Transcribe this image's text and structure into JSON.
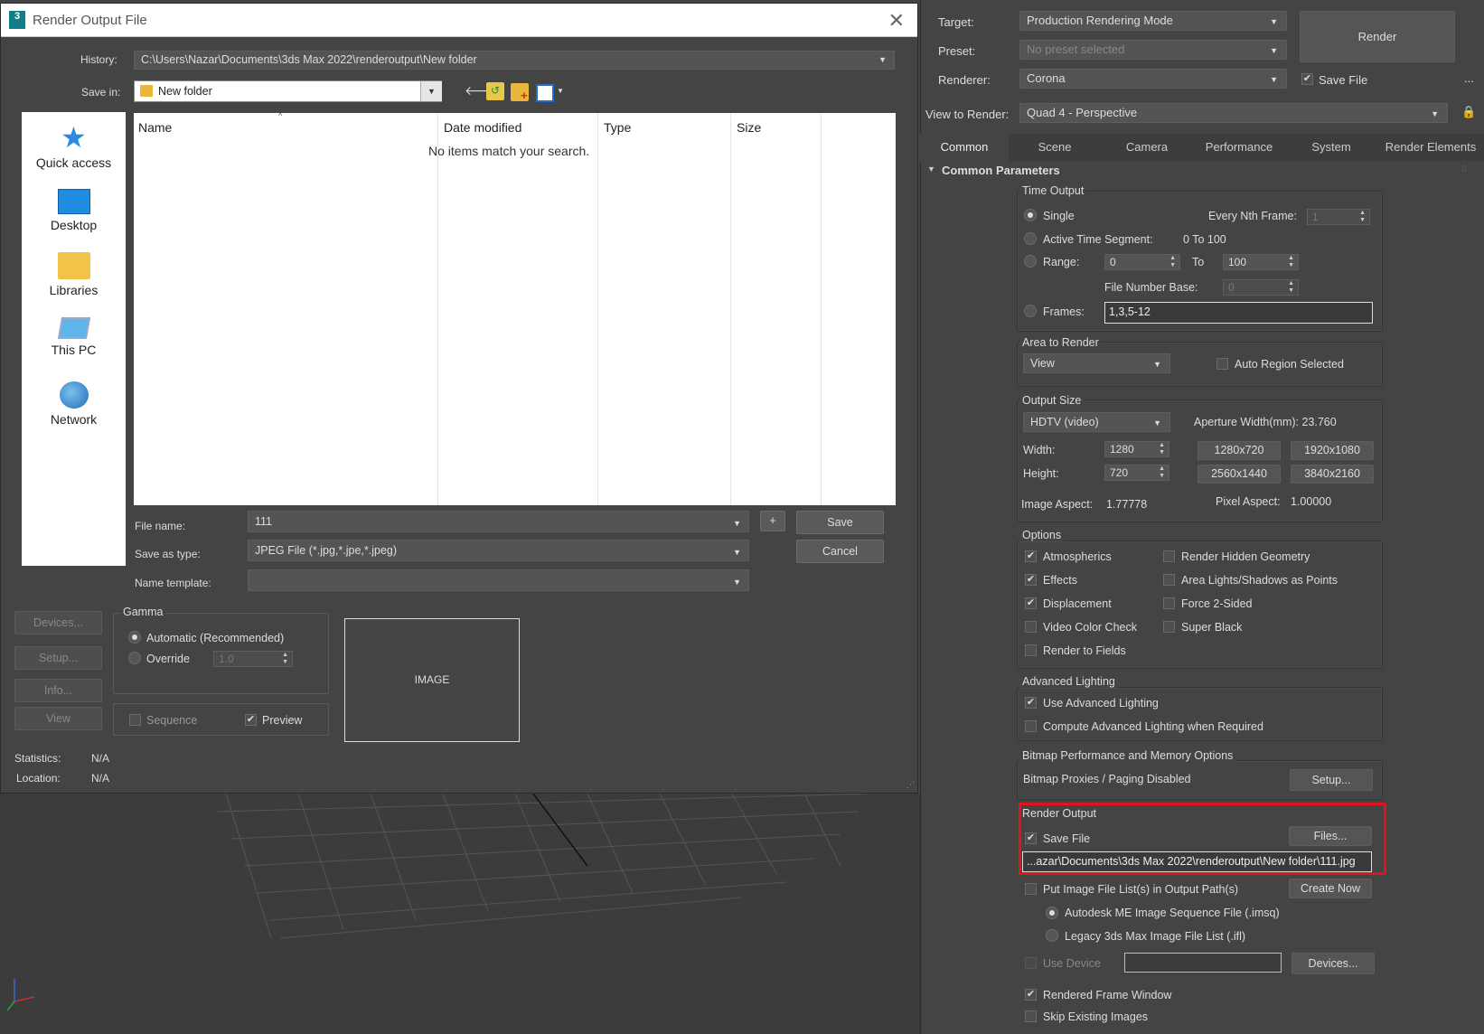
{
  "dialog": {
    "title": "Render Output File",
    "history_label": "History:",
    "history_value": "C:\\Users\\Nazar\\Documents\\3ds Max 2022\\renderoutput\\New folder",
    "save_in_label": "Save in:",
    "save_in_value": "New folder",
    "places": [
      {
        "label": "Quick access",
        "icon": "star-icon"
      },
      {
        "label": "Desktop",
        "icon": "desktop-icon"
      },
      {
        "label": "Libraries",
        "icon": "libraries-icon"
      },
      {
        "label": "This PC",
        "icon": "computer-icon"
      },
      {
        "label": "Network",
        "icon": "network-icon"
      }
    ],
    "columns": [
      "Name",
      "Date modified",
      "Type",
      "Size"
    ],
    "empty_message": "No items match your search.",
    "file_name_label": "File name:",
    "file_name_value": "111",
    "save_as_type_label": "Save as type:",
    "save_as_type_value": "JPEG File (*.jpg,*.jpe,*.jpeg)",
    "name_template_label": "Name template:",
    "name_template_value": "",
    "plus_label": "+",
    "save_label": "Save",
    "cancel_label": "Cancel",
    "devices_label": "Devices...",
    "setup_label": "Setup...",
    "info_label": "Info...",
    "view_label": "View",
    "gamma_title": "Gamma",
    "gamma_auto": "Automatic (Recommended)",
    "gamma_override": "Override",
    "gamma_value": "1.0",
    "sequence_label": "Sequence",
    "preview_label": "Preview",
    "image_label": "IMAGE",
    "statistics_label": "Statistics:",
    "statistics_value": "N/A",
    "location_label": "Location:",
    "location_value": "N/A"
  },
  "render_setup": {
    "target_label": "Target:",
    "target_value": "Production Rendering Mode",
    "preset_label": "Preset:",
    "preset_value": "No preset selected",
    "renderer_label": "Renderer:",
    "renderer_value": "Corona",
    "save_file_label": "Save File",
    "render_label": "Render",
    "more_label": "...",
    "view_to_render_label": "View to Render:",
    "view_to_render_value": "Quad 4 - Perspective",
    "tabs": [
      "Common",
      "Scene",
      "Camera",
      "Performance",
      "System",
      "Render Elements"
    ],
    "rollout_title": "Common Parameters",
    "time_output": {
      "title": "Time Output",
      "single": "Single",
      "every_nth_label": "Every Nth Frame:",
      "every_nth_value": "1",
      "active_segment_label": "Active Time Segment:",
      "active_segment_value": "0 To 100",
      "range_label": "Range:",
      "range_from": "0",
      "to_label": "To",
      "range_to": "100",
      "file_number_base_label": "File Number Base:",
      "file_number_base_value": "0",
      "frames_label": "Frames:",
      "frames_value": "1,3,5-12"
    },
    "area_to_render": {
      "title": "Area to Render",
      "value": "View",
      "auto_region": "Auto Region Selected"
    },
    "output_size": {
      "title": "Output Size",
      "preset": "HDTV (video)",
      "aperture": "Aperture Width(mm): 23.760",
      "width_label": "Width:",
      "width_value": "1280",
      "height_label": "Height:",
      "height_value": "720",
      "presets": [
        "1280x720",
        "1920x1080",
        "2560x1440",
        "3840x2160"
      ],
      "image_aspect_label": "Image Aspect:",
      "image_aspect_value": "1.77778",
      "pixel_aspect_label": "Pixel Aspect:",
      "pixel_aspect_value": "1.00000"
    },
    "options": {
      "title": "Options",
      "left": [
        {
          "label": "Atmospherics",
          "checked": true
        },
        {
          "label": "Effects",
          "checked": true
        },
        {
          "label": "Displacement",
          "checked": true
        },
        {
          "label": "Video Color Check",
          "checked": false
        },
        {
          "label": "Render to Fields",
          "checked": false
        }
      ],
      "right": [
        {
          "label": "Render Hidden Geometry",
          "checked": false
        },
        {
          "label": "Area Lights/Shadows as Points",
          "checked": false
        },
        {
          "label": "Force 2-Sided",
          "checked": false
        },
        {
          "label": "Super Black",
          "checked": false
        }
      ]
    },
    "advanced_lighting": {
      "title": "Advanced Lighting",
      "use": "Use Advanced Lighting",
      "compute": "Compute Advanced Lighting when Required"
    },
    "bitmap": {
      "title": "Bitmap Performance and Memory Options",
      "status": "Bitmap Proxies / Paging Disabled",
      "setup_label": "Setup..."
    },
    "render_output": {
      "title": "Render Output",
      "save_file": "Save File",
      "files_label": "Files...",
      "path": "...azar\\Documents\\3ds Max 2022\\renderoutput\\New folder\\111.jpg",
      "put_image_list": "Put Image File List(s) in Output Path(s)",
      "create_now": "Create Now",
      "imsq": "Autodesk ME Image Sequence File (.imsq)",
      "ifl": "Legacy 3ds Max Image File List (.ifl)",
      "use_device": "Use Device",
      "devices_label": "Devices...",
      "rendered_frame_window": "Rendered Frame Window",
      "skip_existing": "Skip Existing Images"
    }
  },
  "colors": {
    "highlight": "#e0141b",
    "panel_bg": "#444444",
    "accent_blue": "#1e90ff"
  }
}
